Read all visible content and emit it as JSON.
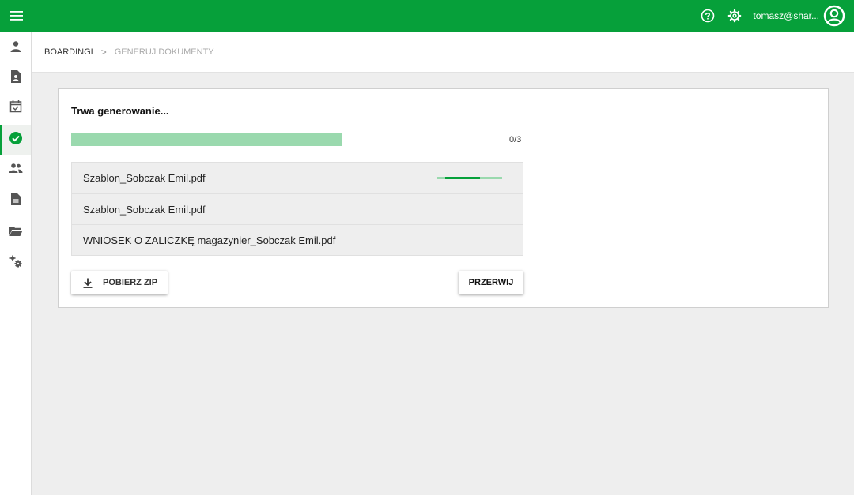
{
  "topbar": {
    "menu_icon": "hamburger-menu-icon",
    "help_icon": "help-circle-icon",
    "settings_icon": "gear-icon",
    "user_name": "tomasz@shar...",
    "avatar_icon": "account-circle-icon",
    "background_color": "#06a03a"
  },
  "sidebar": {
    "items": [
      {
        "icon": "person-icon",
        "active": false
      },
      {
        "icon": "person-document-icon",
        "active": false
      },
      {
        "icon": "calendar-check-icon",
        "active": false
      },
      {
        "icon": "check-circle-icon",
        "active": true
      },
      {
        "icon": "people-icon",
        "active": false
      },
      {
        "icon": "document-icon",
        "active": false
      },
      {
        "icon": "folder-open-icon",
        "active": false
      },
      {
        "icon": "cogs-icon",
        "active": false
      }
    ]
  },
  "breadcrumb": {
    "parent": "BOARDINGI",
    "separator": ">",
    "current": "GENERUJ DOKUMENTY"
  },
  "generation": {
    "title": "Trwa generowanie...",
    "progress_fraction": 0,
    "progress_count": "0/3",
    "files": [
      {
        "name": "Szablon_Sobczak Emil.pdf",
        "in_progress": true
      },
      {
        "name": "Szablon_Sobczak Emil.pdf",
        "in_progress": false
      },
      {
        "name": "WNIOSEK O ZALICZKĘ magazynier_Sobczak Emil.pdf",
        "in_progress": false
      }
    ],
    "download_button": "POBIERZ ZIP",
    "download_icon": "download-icon",
    "stop_button": "PRZERWIJ"
  },
  "colors": {
    "accent": "#06a03a",
    "progress_track": "#9ad9ae"
  }
}
